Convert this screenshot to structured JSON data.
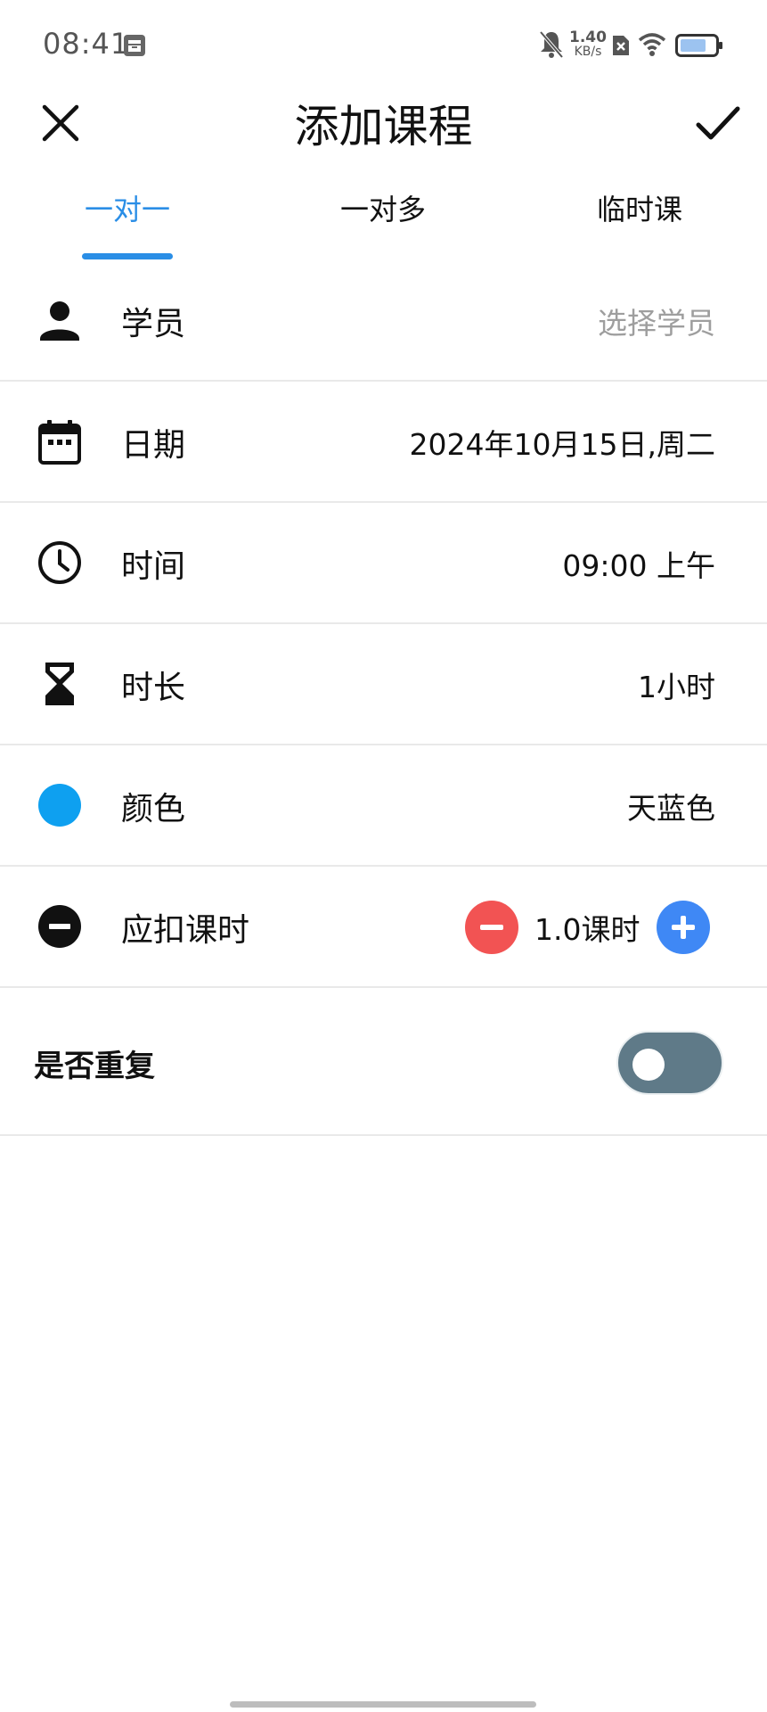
{
  "status_bar": {
    "time": "08:41",
    "net_speed_value": "1.40",
    "net_speed_unit": "KB/s",
    "battery_color": "#9cc3f0"
  },
  "header": {
    "title": "添加课程",
    "close_icon": "close-icon",
    "confirm_icon": "check-icon"
  },
  "tabs": [
    {
      "label": "一对一",
      "active": true
    },
    {
      "label": "一对多",
      "active": false
    },
    {
      "label": "临时课",
      "active": false
    }
  ],
  "form": {
    "student": {
      "label": "学员",
      "placeholder": "选择学员",
      "icon": "person-icon"
    },
    "date": {
      "label": "日期",
      "value": "2024年10月15日,周二",
      "icon": "calendar-icon"
    },
    "time": {
      "label": "时间",
      "value": "09:00 上午",
      "icon": "clock-icon"
    },
    "duration": {
      "label": "时长",
      "value": "1小时",
      "icon": "hourglass-icon"
    },
    "color": {
      "label": "颜色",
      "value": "天蓝色",
      "swatch": "#0ea0f0",
      "icon": "color-dot-icon"
    },
    "lesson_hours": {
      "label": "应扣课时",
      "value": "1.0课时",
      "icon": "minus-circle-icon"
    },
    "repeat": {
      "label": "是否重复",
      "enabled": false
    }
  },
  "colors": {
    "accent": "#2a8ee6",
    "minus": "#f25353",
    "plus": "#3f88f5",
    "toggle_off": "#5f7a88"
  }
}
